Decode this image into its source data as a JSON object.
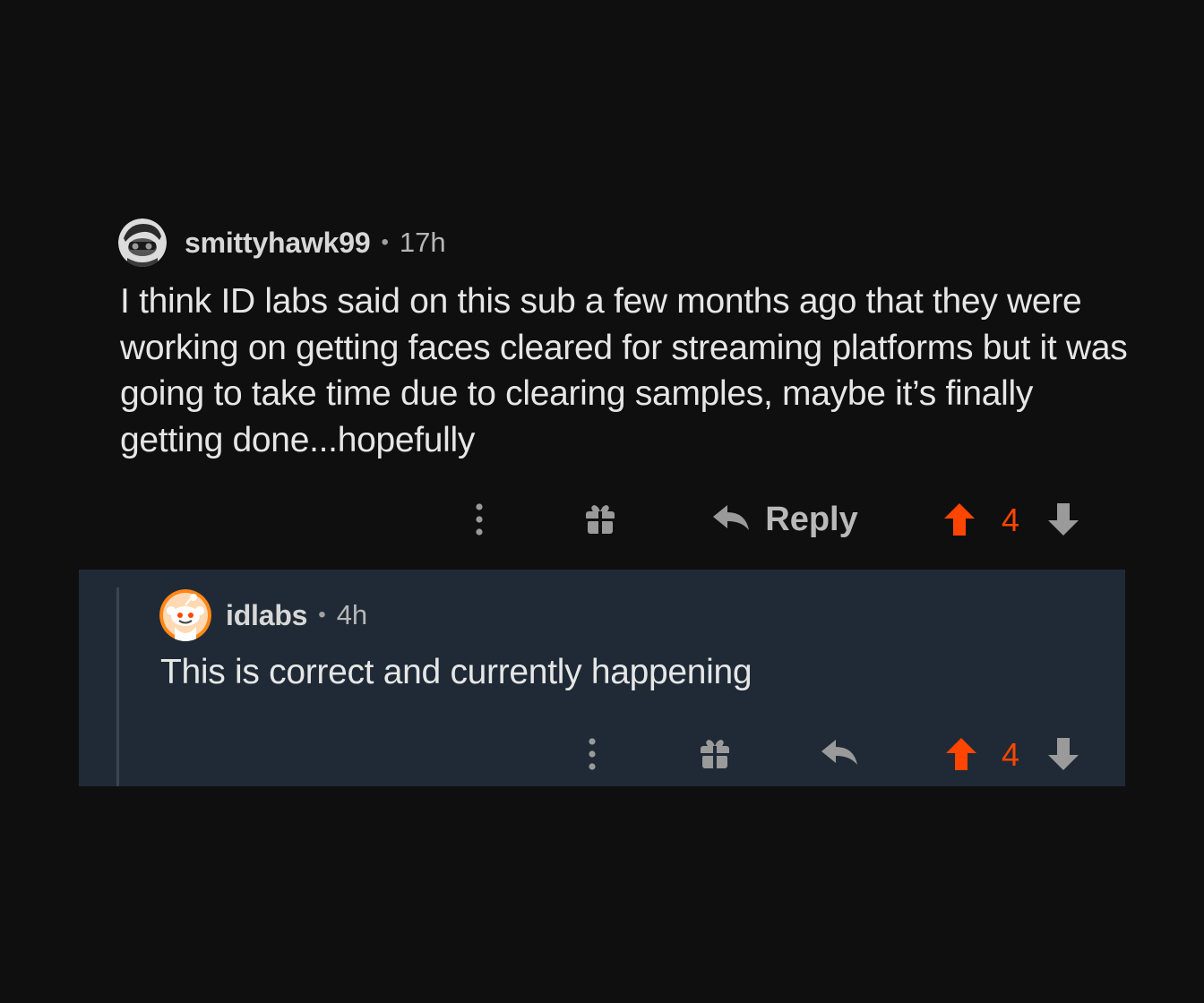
{
  "parent_comment": {
    "username": "smittyhawk99",
    "separator": "•",
    "timestamp": "17h",
    "body": "I think ID labs said on this sub a few months ago that they were working on getting faces cleared for streaming platforms but it was going to take time due to clearing samples, maybe it’s finally getting done...hopefully",
    "actions": {
      "reply_label": "Reply",
      "score": "4"
    }
  },
  "reply_comment": {
    "username": "idlabs",
    "separator": "•",
    "timestamp": "4h",
    "body": "This is correct and currently happening",
    "actions": {
      "score": "4"
    }
  },
  "colors": {
    "background": "#0f0f10",
    "reply_background": "#1f2a36",
    "upvote": "#ff4500",
    "icon_gray": "#9a9a9a"
  },
  "icons": [
    "more-icon",
    "gift-icon",
    "reply-arrow-icon",
    "upvote-icon",
    "downvote-icon"
  ]
}
